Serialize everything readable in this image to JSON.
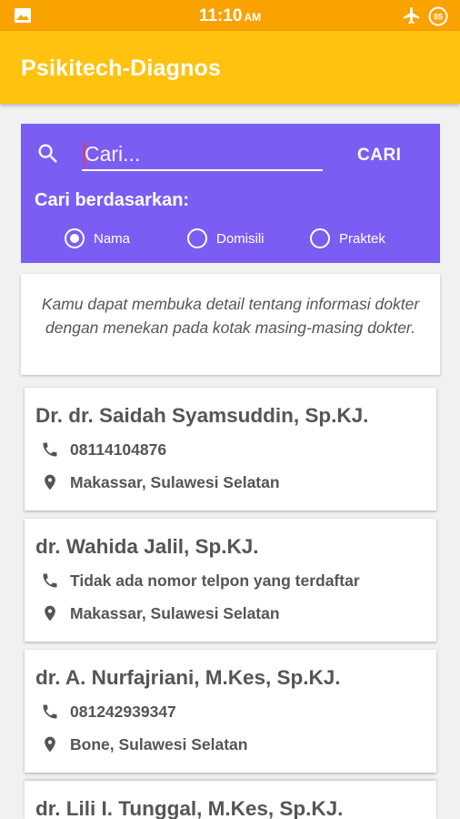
{
  "status_bar": {
    "time": "11:10",
    "ampm": "AM",
    "battery_level": "85"
  },
  "app_bar": {
    "title": "Psikitech-Diagnos"
  },
  "search": {
    "placeholder": "Cari...",
    "value": "",
    "button_label": "CARI",
    "filter_label": "Cari berdasarkan:",
    "options": [
      {
        "label": "Nama",
        "selected": true
      },
      {
        "label": "Domisili",
        "selected": false
      },
      {
        "label": "Praktek",
        "selected": false
      }
    ]
  },
  "info": {
    "text": "Kamu dapat membuka detail tentang informasi dokter dengan menekan pada kotak masing-masing dokter."
  },
  "doctors": [
    {
      "name": "Dr. dr. Saidah Syamsuddin, Sp.KJ.",
      "phone": "08114104876",
      "location": "Makassar, Sulawesi Selatan"
    },
    {
      "name": "dr. Wahida Jalil, Sp.KJ.",
      "phone": "Tidak ada nomor telpon yang terdaftar",
      "location": "Makassar, Sulawesi Selatan"
    },
    {
      "name": "dr. A. Nurfajriani, M.Kes, Sp.KJ.",
      "phone": "081242939347",
      "location": "Bone, Sulawesi Selatan"
    },
    {
      "name": "dr. Lili I. Tunggal, M.Kes, Sp.KJ.",
      "phone": "",
      "location": ""
    }
  ],
  "colors": {
    "status_bar": "#f9a200",
    "app_bar": "#ffc20e",
    "search_panel": "#7b5df4",
    "text_gray": "#555555"
  },
  "icons": {
    "phone": "phone-icon",
    "location": "location-pin-icon",
    "search": "search-icon"
  }
}
